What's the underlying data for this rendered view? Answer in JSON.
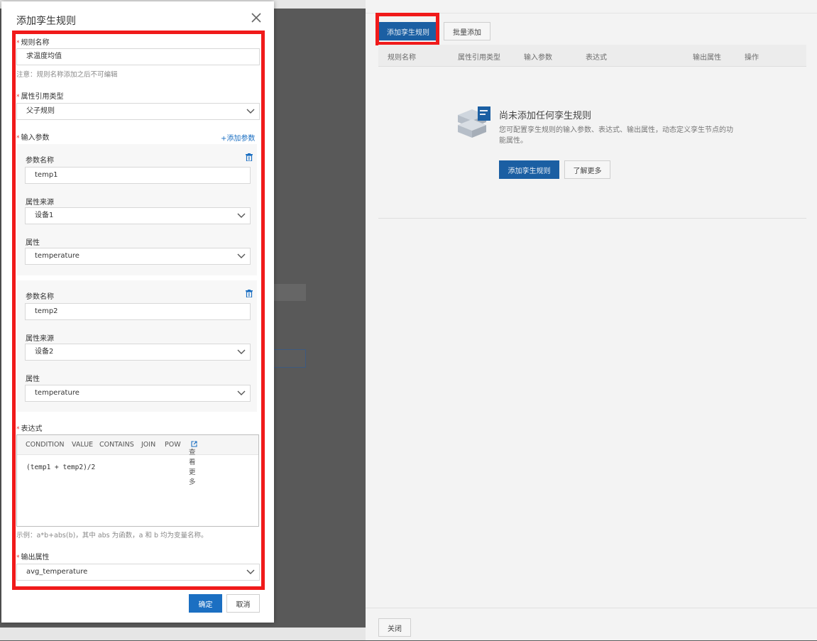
{
  "dialog": {
    "title": "添加孪生规则",
    "rule_name_label": "规则名称",
    "rule_name_value": "求温度均值",
    "rule_name_note": "注意：规则名称添加之后不可编辑",
    "ref_type_label": "属性引用类型",
    "ref_type_value": "父子规则",
    "input_params_label": "输入参数",
    "add_param_link": "+添加参数",
    "params": [
      {
        "name_label": "参数名称",
        "name_value": "temp1",
        "source_label": "属性来源",
        "source_value": "设备1",
        "attr_label": "属性",
        "attr_value": "temperature"
      },
      {
        "name_label": "参数名称",
        "name_value": "temp2",
        "source_label": "属性来源",
        "source_value": "设备2",
        "attr_label": "属性",
        "attr_value": "temperature"
      }
    ],
    "expression_label": "表达式",
    "expr_toolbar": [
      "CONDITION",
      "VALUE",
      "CONTAINS",
      "JOIN",
      "POW"
    ],
    "expr_more": "查看更多",
    "expression_value": "(temp1 + temp2)/2",
    "expression_example": "示例：a*b+abs(b)，其中 abs 为函数，a 和 b 均为变量名称。",
    "output_attr_label": "输出属性",
    "output_attr_value": "avg_temperature",
    "ok_button": "确定",
    "cancel_button": "取消"
  },
  "right_panel": {
    "add_rule_button": "添加孪生规则",
    "batch_add_button": "批量添加",
    "table_columns": [
      "规则名称",
      "属性引用类型",
      "输入参数",
      "表达式",
      "输出属性",
      "操作"
    ],
    "empty_title": "尚未添加任何孪生规则",
    "empty_desc": "您可配置孪生规则的输入参数、表达式、输出属性，动态定义孪生节点的功能属性。",
    "empty_add_button": "添加孪生规则",
    "empty_more_button": "了解更多",
    "close_button": "关闭"
  },
  "colors": {
    "primary": "#1b6fc2",
    "highlight_box": "#f01a1a",
    "required_star": "#e53935"
  },
  "icons": [
    "close-icon",
    "chevron-down-icon",
    "trash-icon",
    "external-link-icon",
    "cube-doc-icon"
  ]
}
